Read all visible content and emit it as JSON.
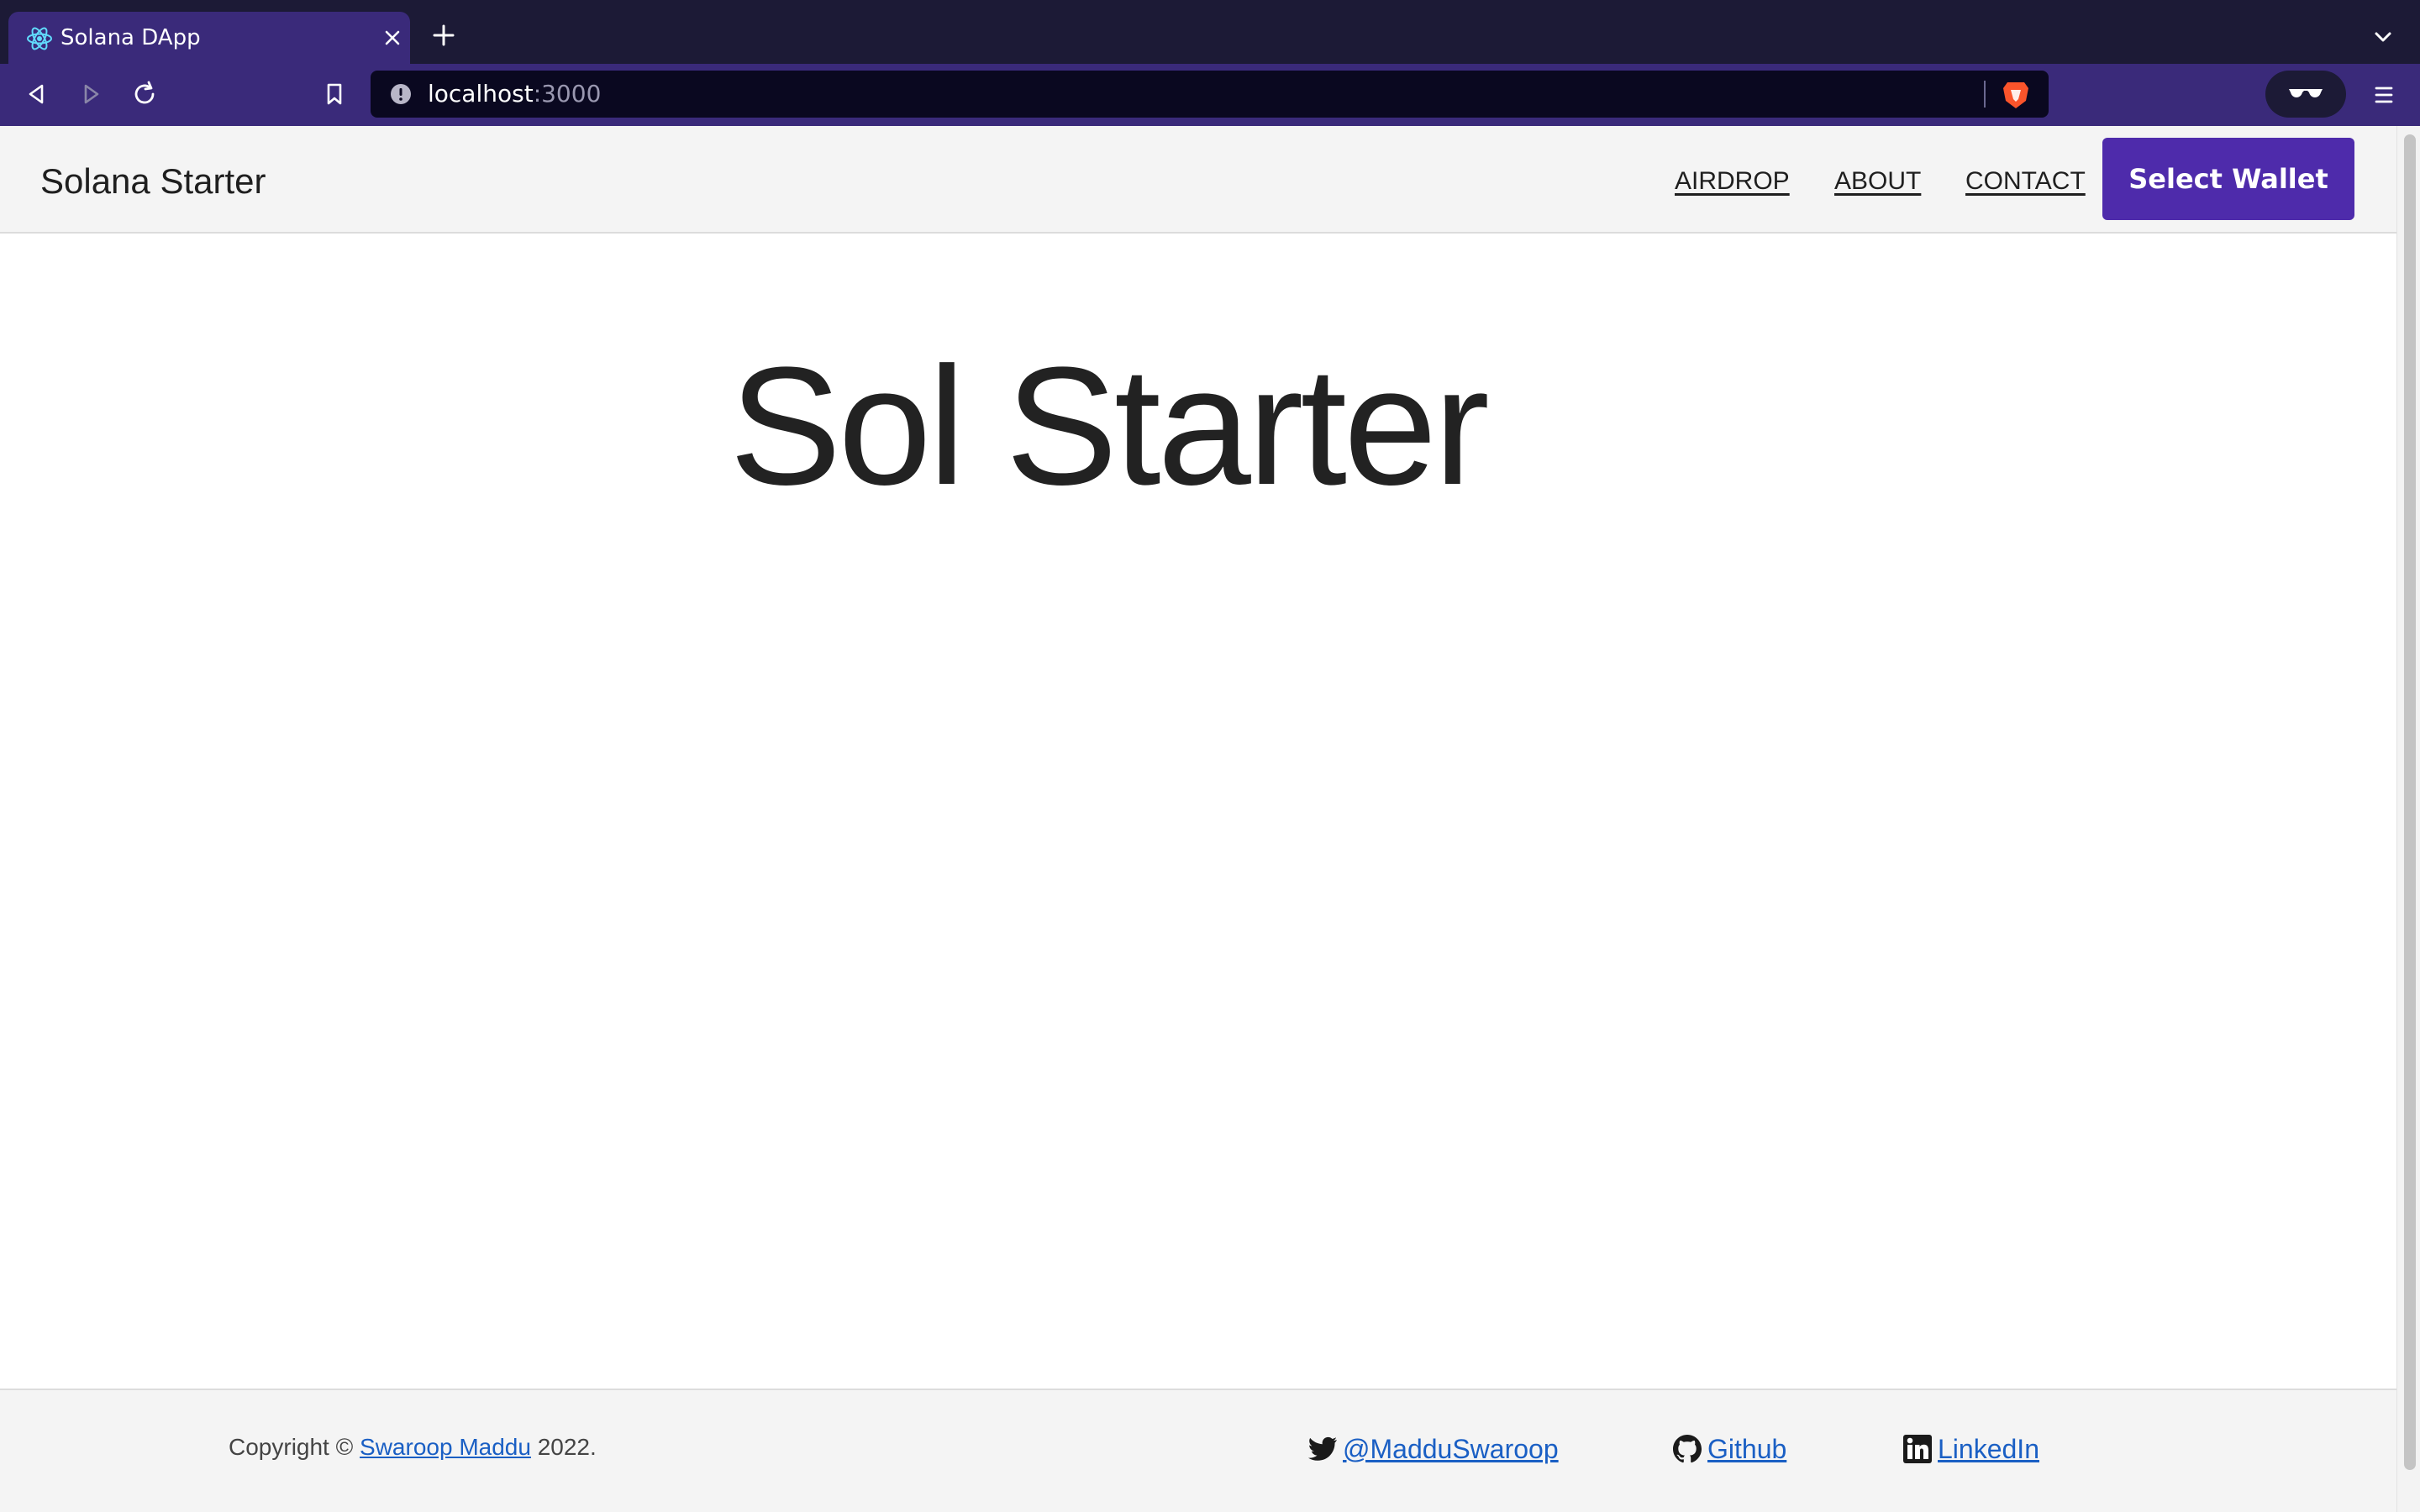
{
  "browser": {
    "tab": {
      "title": "Solana DApp",
      "favicon": "react-icon"
    },
    "address": {
      "host": "localhost",
      "port": ":3000"
    }
  },
  "header": {
    "brand": "Solana Starter",
    "nav": [
      {
        "label": "AIRDROP"
      },
      {
        "label": "ABOUT"
      },
      {
        "label": "CONTACT"
      }
    ],
    "wallet_button": "Select Wallet"
  },
  "main": {
    "title": "Sol Starter"
  },
  "footer": {
    "copyright_prefix": "Copyright ©",
    "author": "Swaroop Maddu",
    "year": "2022.",
    "links": [
      {
        "label": "@MadduSwaroop",
        "icon": "twitter-icon"
      },
      {
        "label": "Github",
        "icon": "github-icon"
      },
      {
        "label": "LinkedIn",
        "icon": "linkedin-icon"
      }
    ]
  },
  "colors": {
    "wallet_button": "#4e2bab",
    "link": "#1a5fc4",
    "chrome": "#3a2a7a"
  }
}
